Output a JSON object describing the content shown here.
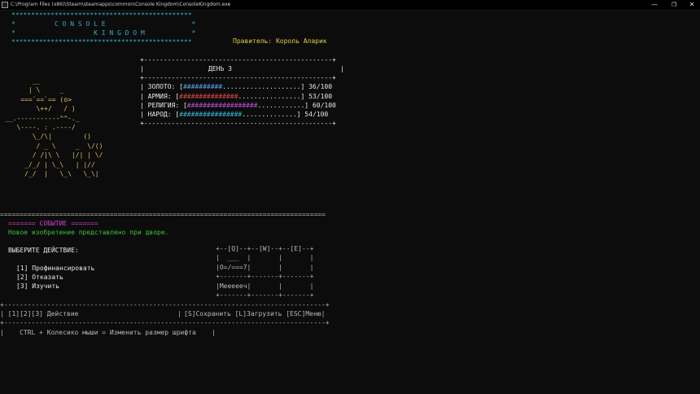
{
  "window": {
    "title": "C:\\Program Files (x86)\\Steam\\steamapps\\common\\Console Kingdom\\ConsoleKingdom.exe",
    "minimize": "—",
    "maximize": "❐",
    "close": "✕"
  },
  "header": {
    "border_top": "**********************************************",
    "title_line1": "*          C O N S O L E                      *",
    "title_line2": "*                    K I N G D O M            *",
    "border_bottom": "**********************************************",
    "ruler": "Правитель: Король Аларик"
  },
  "art": {
    "king": "       __\n      | \\     _\n    ===`==`== (o>\n        \\++/   / )\n__.-----------^^-._\n   \\----. : .----/\n       \\_/\\|        ()\n        / _ \\     _  \\/()\n       / /|\\ \\   |/| | \\/\n     _/_/ | \\_\\   | |//\n     /_/  |   \\_\\   \\_\\|"
  },
  "status": {
    "border_top": "+------------------------------------------------+",
    "day_open": "|",
    "day_label": "ДЕНЬ 3",
    "day_close": "|",
    "resources": [
      {
        "label": "| ЗОЛОТО: [",
        "bar": "##########",
        "dots": "....................",
        "value": "] 36/100",
        "color": "#5aa0f0",
        "level": 0.36
      },
      {
        "label": "| АРМИЯ: [",
        "bar": "###############",
        "dots": "................",
        "value": "] 53/100",
        "color": "#e04848",
        "level": 0.53
      },
      {
        "label": "| РЕЛИГИЯ: [",
        "bar": "##################",
        "dots": "............",
        "value": "] 60/100",
        "color": "#c050d8",
        "level": 0.6
      },
      {
        "label": "| НАРОД: [",
        "bar": "################",
        "dots": "..............",
        "value": "] 54/100",
        "color": "#35b8d8",
        "level": 0.54
      }
    ],
    "border_bottom": "+------------------------------------------------+"
  },
  "divider": "===================================================================================",
  "event": {
    "header": "======= СОБЫТИЕ =======",
    "text": "Новое изобретение представлено при дворе."
  },
  "actions": {
    "prompt": "ВЫБЕРИТЕ ДЕЙСТВИЕ:",
    "options": [
      {
        "key": "[1]",
        "label": "Профинансировать"
      },
      {
        "key": "[2]",
        "label": "Отказать"
      },
      {
        "key": "[3]",
        "label": "Изучить"
      }
    ]
  },
  "keymap": {
    "art": "+--[Q]--+--[W]--+--[E]--+\n|  ___  |       |       |\n|O=/===7|       |       |\n+-------+-------+-------+\n|Meeeeeч|       |       |\n+-------+-------+-------+"
  },
  "footer": {
    "border_top": "+----------------------------------------------------------------------------------+",
    "actions_left": "| [1][2][3] Действие",
    "separator": "|",
    "actions_right": "[S]Сохранить [L]Загрузить [ESC]Меню|",
    "border_mid": "+----------------------------------------------------------------------------------+",
    "hint": "|    CTRL + Колесико мыши = Изменить размер шрифта    |"
  }
}
